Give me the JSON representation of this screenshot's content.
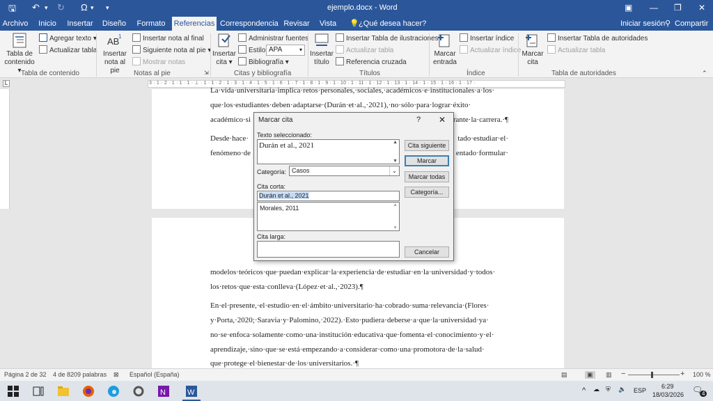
{
  "window": {
    "title": "ejemplo.docx - Word",
    "quick_access": {
      "save": "🖫",
      "undo": "↶",
      "redo": "↻",
      "omega": "Ω",
      "more": "▾"
    }
  },
  "tabs": [
    "Archivo",
    "Inicio",
    "Insertar",
    "Diseño",
    "Formato",
    "Referencias",
    "Correspondencia",
    "Revisar",
    "Vista"
  ],
  "tell_me": "¿Qué desea hacer?",
  "sign_in": "Iniciar sesión",
  "share": "Compartir",
  "ribbon": {
    "toc": {
      "big": "Tabla de contenido",
      "add_text": "Agregar texto",
      "update": "Actualizar tabla",
      "group": "Tabla de contenido"
    },
    "footnotes": {
      "big": "Insertar nota al pie",
      "endnote": "Insertar nota al final",
      "next": "Siguiente nota al pie",
      "show": "Mostrar notas",
      "group": "Notas al pie"
    },
    "citations": {
      "big": "Insertar cita",
      "manage": "Administrar fuentes",
      "style_label": "Estilo:",
      "style_value": "APA",
      "bibliography": "Bibliografía",
      "group": "Citas y bibliografía"
    },
    "captions": {
      "big": "Insertar título",
      "insert_table": "Insertar Tabla de ilustraciones",
      "update": "Actualizar tabla",
      "cross": "Referencia cruzada",
      "group": "Títulos"
    },
    "index": {
      "big": "Marcar entrada",
      "insert": "Insertar índice",
      "update": "Actualizar índice",
      "group": "Índice"
    },
    "authorities": {
      "big": "Marcar cita",
      "insert": "Insertar Tabla de autoridades",
      "update": "Actualizar tabla",
      "group": "Tabla de autoridades"
    }
  },
  "ruler": {
    "numbers": "3 · 1 · 2 · 1 · 1 · 1 · ⊥ · 1 · 1 · 2 · 1 · 3 · 1 · 4 · 1 · 5 · 1 · 6 · 1 · 7 · 1 · 8 · 1 · 9 · 1 · 10 · 1 · 11 · 1 · 12 · 1 · 13 · 1 · 14 · 1 · 15 · 1 · 16 · 1 · 17 ·"
  },
  "document": {
    "p1_l1": "La·vida·universitaria·implica·retos·personales,·sociales,·académicos·e·institucionales·a·los·",
    "p1_l2": "que·los·estudiantes·deben·adaptarse·(Durán·et·al.,·2021),·no·sólo·para·lograr·éxito·",
    "p1_l3a": "académico·si",
    "p1_l3b": "rante·la·carrera.·¶",
    "p2_l1a": "Desde·hace·",
    "p2_l1b": "tado·estudiar·el·",
    "p2_l2a": "fenómeno·de",
    "p2_l2b": "entado·formular·",
    "p3_l1": "modelos·teóricos·que·puedan·explicar·la·experiencia·de·estudiar·en·la·universidad·y·todos·",
    "p3_l2": "los·retos·que·esta·conlleva·(López·et·al.,·2023).¶",
    "p4_l1": "En·el·presente,·el·estudio·en·el·ámbito·universitario·ha·cobrado·suma·relevancia·(Flores·",
    "p4_l2": "y·Porta,·2020;·Saravia·y·Palomino,·2022).·Esto·pudiera·deberse·a·que·la·universidad·ya·",
    "p4_l3": "no·se·enfoca·solamente·como·una·institución·educativa·que·fomenta·el·conocimiento·y·el·",
    "p4_l4": "aprendizaje,·sino·que·se·está·empezando·a·considerar·como·una·promotora·de·la·salud·",
    "p4_l5": "que·protege·el·bienestar·de·los·universitarios.·¶"
  },
  "dialog": {
    "title": "Marcar cita",
    "help": "?",
    "close": "✕",
    "selected_label": "Texto seleccionado:",
    "selected_text": "Durán et al., 2021",
    "category_label": "Categoría:",
    "category_value": "Casos",
    "short_label": "Cita corta:",
    "short_value": "Durán et al., 2021",
    "short_list": [
      "Morales, 2011"
    ],
    "long_label": "Cita larga:",
    "long_value": "",
    "buttons": {
      "next": "Cita siguiente",
      "mark": "Marcar",
      "mark_all": "Marcar todas",
      "category": "Categoría...",
      "cancel": "Cancelar"
    }
  },
  "status": {
    "page": "Página 2 de 32",
    "words": "4 de 8209 palabras",
    "language": "Español (España)",
    "zoom": "100 %",
    "zoom_minus": "−",
    "zoom_plus": "+"
  },
  "taskbar": {
    "lang": "ESP",
    "time": "6:29",
    "date": "18/03/2026",
    "notifications": "4"
  }
}
